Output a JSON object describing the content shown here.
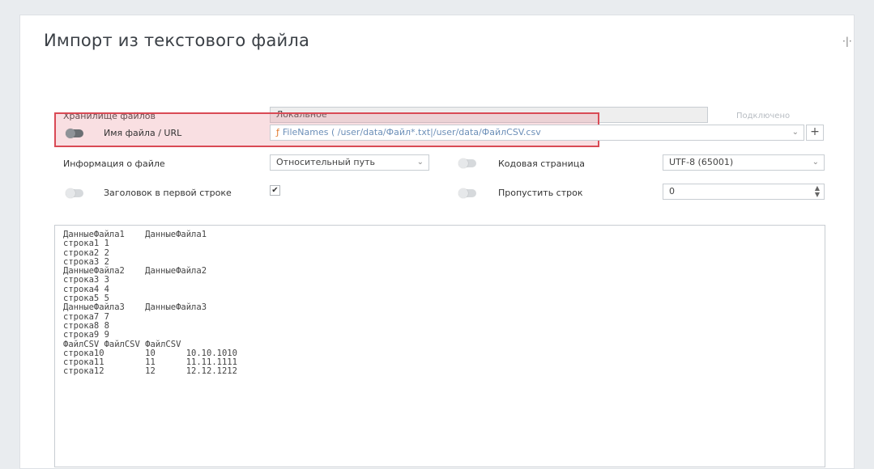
{
  "dialog": {
    "title": "Импорт из текстового файла",
    "storage": {
      "label": "Хранилище файлов",
      "value": "Локальное",
      "link": "Подключено"
    },
    "filename": {
      "label": "Имя файла / URL",
      "value": "FileNames ( /user/data/Файл*.txt|/user/data/ФайлCSV.csv",
      "fx_icon": "function-icon"
    },
    "fileinfo": {
      "label": "Информация о файле",
      "value": "Относительный путь"
    },
    "codepage": {
      "label": "Кодовая страница",
      "value": "UTF-8 (65001)"
    },
    "header_row": {
      "label": "Заголовок в первой строке",
      "checked": "✔"
    },
    "skip_rows": {
      "label": "Пропустить строк",
      "value": "0"
    },
    "plus": "+",
    "preview_text": "ДанныеФайла1\tДанныеФайла1\nстрока1 1\nстрока2 2\nстрока3 2\nДанныеФайла2\tДанныеФайла2\nстрока3 3\nстрока4 4\nстрока5 5\nДанныеФайла3\tДанныеФайла3\nстрока7 7\nстрока8 8\nстрока9 9\nФайлCSV ФайлCSV ФайлCSV\nстрока10\t10\t10.10.1010\nстрока11\t11\t11.11.1111\nстрока12\t12\t12.12.1212"
  },
  "colors": {
    "highlight_border": "#d94a55",
    "link": "#6c8fb8"
  }
}
